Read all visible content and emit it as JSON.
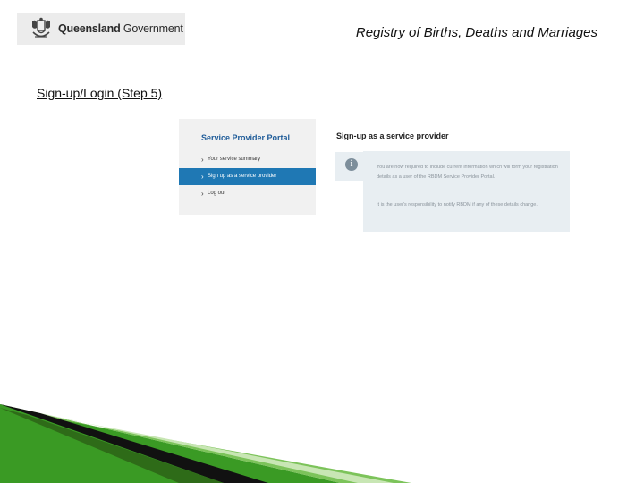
{
  "header": {
    "logo_bold": "Queensland",
    "logo_regular": "Government",
    "registry_title": "Registry of Births, Deaths and Marriages"
  },
  "slide": {
    "step_label": "Sign-up/Login (Step 5)"
  },
  "portal": {
    "title": "Service Provider Portal",
    "items": [
      {
        "label": "Your service summary",
        "active": false
      },
      {
        "label": "Sign up as a service provider",
        "active": true
      },
      {
        "label": "Log out",
        "active": false
      }
    ]
  },
  "signup": {
    "title": "Sign-up as a service provider",
    "info_paragraph_1": "You are now required to include current information which will form your registration details as a user of the RBDM Service Provider Portal.",
    "info_paragraph_2": "It is the user's responsibility to notify RBDM if any of these details change."
  },
  "colors": {
    "portal_title": "#1f5c99",
    "active_item": "#1f78b4",
    "panel_bg": "#e8eef2",
    "corner_green": "#2e8b1f"
  }
}
